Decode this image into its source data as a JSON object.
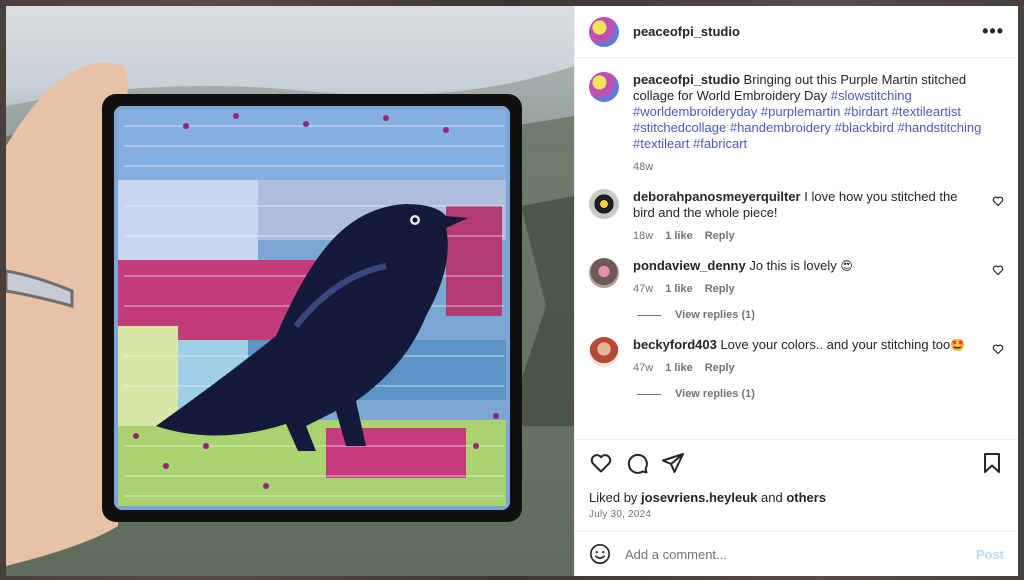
{
  "header": {
    "username": "peaceofpi_studio",
    "more_icon": "more-horizontal-icon"
  },
  "caption": {
    "username": "peaceofpi_studio",
    "text": "Bringing out this Purple Martin stitched collage for World Embroidery Day",
    "hashtags": "#slowstitching #worldembroideryday #purplemartin #birdart #textileartist #stitchedcollage #handembroidery #blackbird #handstitching #textileart #fabricart",
    "age": "48w"
  },
  "comments": [
    {
      "username": "deborahpanosmeyerquilter",
      "text": "I love how you stitched the bird and the whole piece!",
      "age": "18w",
      "likes": "1 like",
      "reply": "Reply"
    },
    {
      "username": "pondaview_denny",
      "text": "Jo this is lovely",
      "emoji": "😍",
      "age": "47w",
      "likes": "1 like",
      "reply": "Reply",
      "view_replies": "View replies (1)"
    },
    {
      "username": "beckyford403",
      "text": "Love your colors.. and your stitching too",
      "emoji": "🤩",
      "age": "47w",
      "likes": "1 like",
      "reply": "Reply",
      "view_replies": "View replies (1)"
    }
  ],
  "actions": {
    "icons": [
      "heart-icon",
      "comment-icon",
      "share-icon",
      "bookmark-icon"
    ],
    "liked_prefix": "Liked by",
    "liked_user": "josevriens.heyleuk",
    "liked_and": "and",
    "liked_others": "others",
    "date": "July 30, 2024"
  },
  "add_comment": {
    "placeholder": "Add a comment...",
    "post_label": "Post",
    "emoji_icon": "emoji-icon"
  },
  "colors": {
    "hashtag": "#4a5ac7",
    "post_button_disabled": "#b2dffc",
    "secondary_text": "#737373"
  }
}
